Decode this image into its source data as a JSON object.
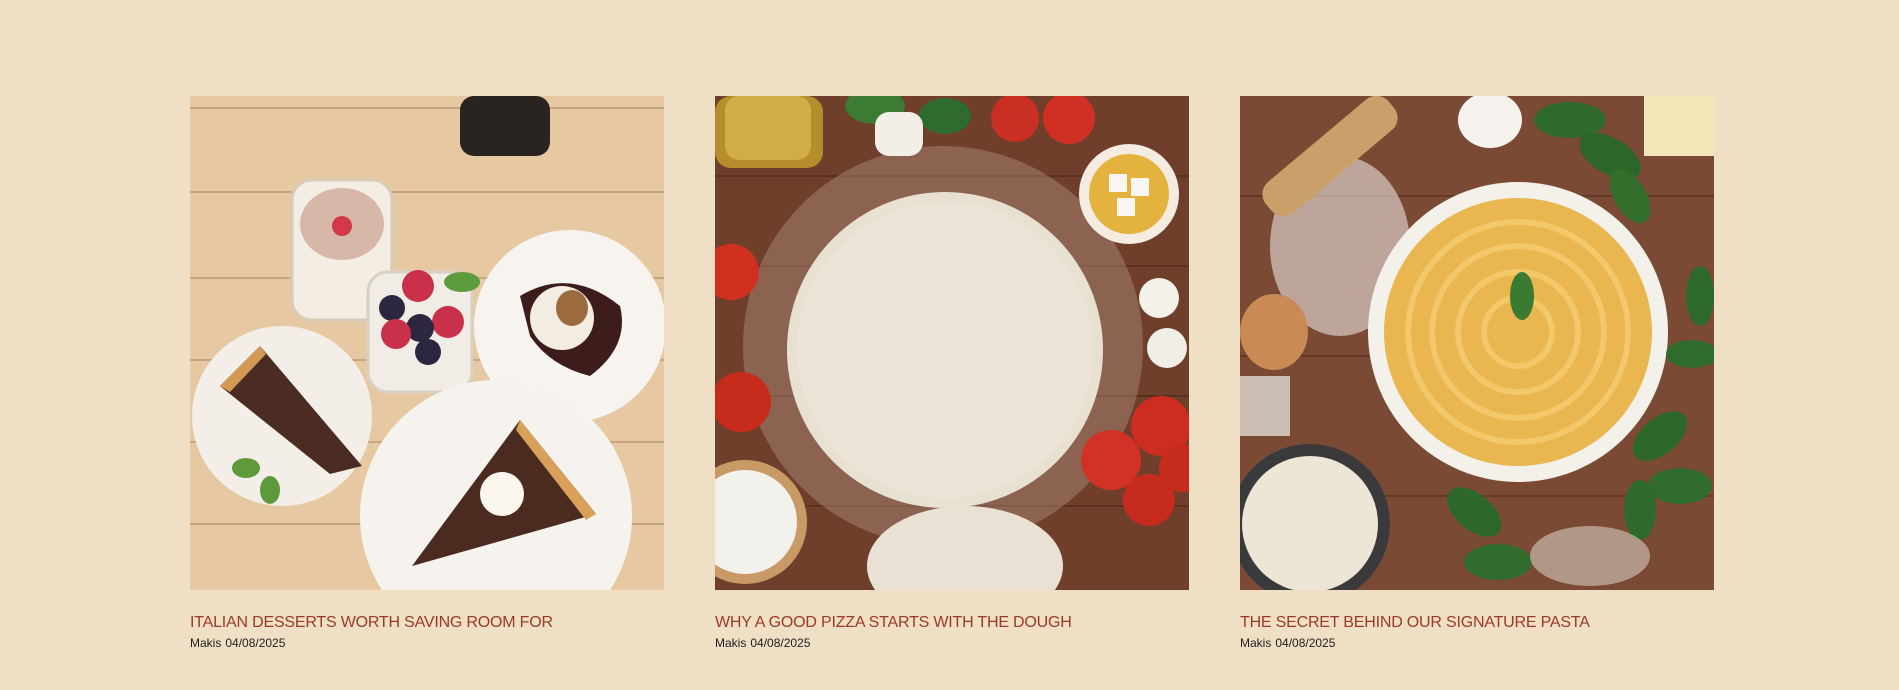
{
  "posts": [
    {
      "image_icon": "desserts-photo",
      "title": "ITALIAN DESSERTS WORTH SAVING ROOM FOR",
      "author": "Makis",
      "date": "04/08/2025"
    },
    {
      "image_icon": "pizza-dough-photo",
      "title": "WHY A GOOD PIZZA STARTS WITH THE DOUGH",
      "author": "Makis",
      "date": "04/08/2025"
    },
    {
      "image_icon": "pasta-photo",
      "title": "THE SECRET BEHIND OUR SIGNATURE PASTA",
      "author": "Makis",
      "date": "04/08/2025"
    }
  ],
  "colors": {
    "background": "#efdfc4",
    "title": "#9a3a27",
    "meta": "#1e1e1e"
  }
}
